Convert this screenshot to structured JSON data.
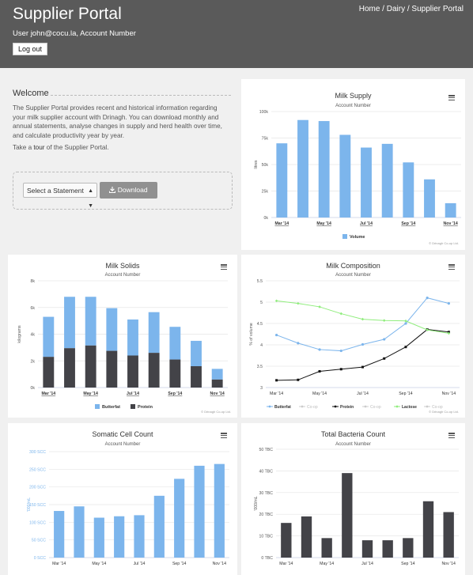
{
  "header": {
    "title": "Supplier Portal",
    "breadcrumb": "Home / Dairy / Supplier Portal",
    "user_line": "User john@cocu.la, Account Number",
    "logout_label": "Log out"
  },
  "welcome": {
    "title": "Welcome",
    "body": "The Supplier Portal provides recent and historical information regarding your milk supplier account with Drinagh. You can download monthly and annual statements, analyse changes in supply and herd health over time, and calculate productivity year by year.",
    "tour_prefix": "Take a ",
    "tour_link": "tour",
    "tour_suffix": " of the Supplier Portal.",
    "select_label": "Select a Statement",
    "download_label": "Download",
    "icons": {
      "caret": "updown-caret-icon",
      "download": "download-icon",
      "menu": "hamburger-menu-icon"
    }
  },
  "colors": {
    "blue": "#7cb5ec",
    "dark": "#434348",
    "green": "#90ed7d",
    "axis_blue": "#7cb5ec"
  },
  "credit": "© Drinagh Co-op Ltd.",
  "chart_data": [
    {
      "id": "milk_supply",
      "type": "bar",
      "title": "Milk Supply",
      "subtitle": "Account Number",
      "ylabel": "litres",
      "categories": [
        "Mar '14",
        "Apr '14",
        "May '14",
        "Jun '14",
        "Jul '14",
        "Aug '14",
        "Sep '14",
        "Oct '14",
        "Nov '14"
      ],
      "x_tick_labels": [
        "Mar '14",
        "May '14",
        "Jul '14",
        "Sep '14",
        "Nov '14"
      ],
      "y_tick_labels": [
        "0k",
        "25k",
        "50k",
        "75k",
        "100k"
      ],
      "ylim": [
        0,
        100000
      ],
      "series": [
        {
          "name": "Volume",
          "values": [
            70000,
            92000,
            91000,
            78000,
            66000,
            69500,
            52000,
            36000,
            13500
          ]
        }
      ],
      "legend": "bottom-center",
      "grid": true
    },
    {
      "id": "milk_solids",
      "type": "bar",
      "stacked": true,
      "title": "Milk Solids",
      "subtitle": "Account Number",
      "ylabel": "kilograms",
      "categories": [
        "Mar '14",
        "Apr '14",
        "May '14",
        "Jun '14",
        "Jul '14",
        "Aug '14",
        "Sep '14",
        "Oct '14",
        "Nov '14"
      ],
      "x_tick_labels": [
        "Mar '14",
        "May '14",
        "Jul '14",
        "Sep '14",
        "Nov '14"
      ],
      "y_tick_labels": [
        "0k",
        "2k",
        "4k",
        "6k",
        "8k"
      ],
      "ylim": [
        0,
        8000
      ],
      "series": [
        {
          "name": "Butterfat",
          "values": [
            3000,
            3850,
            3650,
            3200,
            2700,
            3050,
            2450,
            1900,
            800
          ]
        },
        {
          "name": "Protein",
          "values": [
            2300,
            2950,
            3150,
            2750,
            2400,
            2600,
            2100,
            1600,
            600
          ]
        }
      ],
      "legend": "bottom-center",
      "grid": true
    },
    {
      "id": "milk_composition",
      "type": "line",
      "title": "Milk Composition",
      "subtitle": "Account Number",
      "ylabel": "% of volume",
      "categories": [
        "Mar '14",
        "Apr '14",
        "May '14",
        "Jun '14",
        "Jul '14",
        "Aug '14",
        "Sep '14",
        "Oct '14",
        "Nov '14"
      ],
      "x_tick_labels": [
        "Mar '14",
        "May '14",
        "Jul '14",
        "Sep '14",
        "Nov '14"
      ],
      "y_tick_labels": [
        "3",
        "3.5",
        "4",
        "4.5",
        "5",
        "5.5"
      ],
      "ylim": [
        3,
        5.5
      ],
      "series": [
        {
          "name": "Butterfat",
          "values": [
            4.23,
            4.04,
            3.89,
            3.86,
            4.01,
            4.13,
            4.5,
            5.1,
            4.97
          ]
        },
        {
          "name": "Protein",
          "values": [
            3.17,
            3.18,
            3.38,
            3.43,
            3.48,
            3.68,
            3.95,
            4.36,
            4.3
          ]
        },
        {
          "name": "Lactose",
          "values": [
            5.03,
            4.97,
            4.89,
            4.73,
            4.6,
            4.57,
            4.56,
            4.35,
            4.27
          ]
        }
      ],
      "legend_items": [
        "Butterfat",
        "Co-op",
        "Protein",
        "Co-op",
        "Lactose",
        "Co-op"
      ],
      "legend": "bottom-center",
      "grid": true
    },
    {
      "id": "somatic_cell_count",
      "type": "bar",
      "title": "Somatic Cell Count",
      "subtitle": "Account Number",
      "ylabel": "'000/mL",
      "categories": [
        "Mar '14",
        "Apr '14",
        "May '14",
        "Jun '14",
        "Jul '14",
        "Aug '14",
        "Sep '14",
        "Oct '14",
        "Nov '14"
      ],
      "x_tick_labels": [
        "Mar '14",
        "May '14",
        "Jul '14",
        "Sep '14",
        "Nov '14"
      ],
      "y_tick_labels": [
        "0 SCC",
        "50 SCC",
        "100 SCC",
        "150 SCC",
        "200 SCC",
        "250 SCC",
        "300 SCC"
      ],
      "ylim": [
        0,
        300
      ],
      "series": [
        {
          "name": "SCC",
          "values": [
            132,
            145,
            113,
            117,
            120,
            175,
            223,
            260,
            265
          ]
        }
      ],
      "grid": true
    },
    {
      "id": "total_bacteria_count",
      "type": "bar",
      "title": "Total Bacteria Count",
      "subtitle": "Account Number",
      "ylabel": "'000/mL",
      "categories": [
        "Mar '14",
        "Apr '14",
        "May '14",
        "Jun '14",
        "Jul '14",
        "Aug '14",
        "Sep '14",
        "Oct '14",
        "Nov '14"
      ],
      "x_tick_labels": [
        "Mar '14",
        "May '14",
        "Jul '14",
        "Sep '14",
        "Nov '14"
      ],
      "y_tick_labels": [
        "0 TBC",
        "10 TBC",
        "20 TBC",
        "30 TBC",
        "40 TBC",
        "50 TBC"
      ],
      "ylim": [
        0,
        50
      ],
      "series": [
        {
          "name": "TBC",
          "values": [
            16,
            19,
            9,
            39,
            8,
            8,
            9,
            26,
            21
          ]
        }
      ],
      "grid": true
    }
  ]
}
